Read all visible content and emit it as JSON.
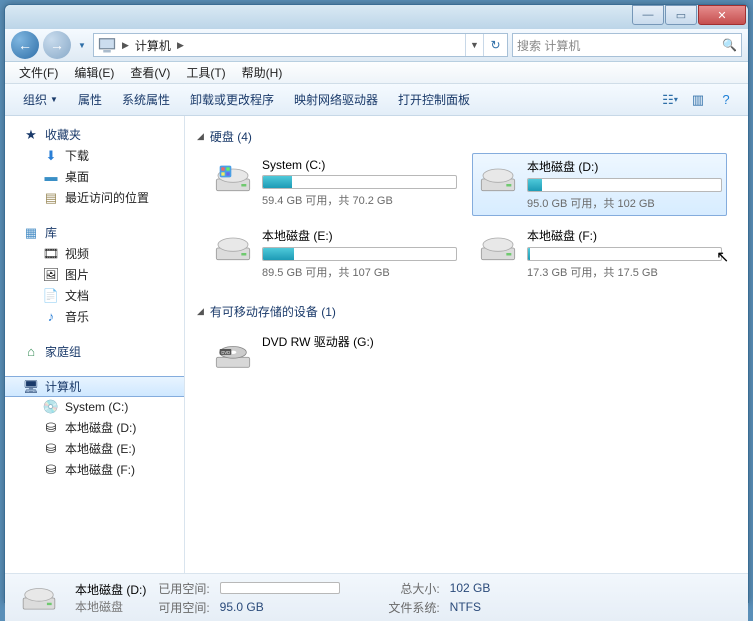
{
  "titlebar": {},
  "nav": {
    "breadcrumb_seg": "计算机",
    "search_placeholder": "搜索 计算机"
  },
  "menubar": {
    "file": "文件(F)",
    "edit": "编辑(E)",
    "view": "查看(V)",
    "tools": "工具(T)",
    "help": "帮助(H)"
  },
  "toolbar": {
    "organize": "组织",
    "properties": "属性",
    "sys_properties": "系统属性",
    "uninstall": "卸载或更改程序",
    "map_drive": "映射网络驱动器",
    "control_panel": "打开控制面板"
  },
  "sidebar": {
    "favorites": {
      "head": "收藏夹",
      "items": [
        "下载",
        "桌面",
        "最近访问的位置"
      ]
    },
    "libraries": {
      "head": "库",
      "items": [
        "视频",
        "图片",
        "文档",
        "音乐"
      ]
    },
    "homegroup": {
      "head": "家庭组"
    },
    "computer": {
      "head": "计算机",
      "items": [
        "System (C:)",
        "本地磁盘 (D:)",
        "本地磁盘 (E:)",
        "本地磁盘 (F:)"
      ]
    }
  },
  "content": {
    "group_hdd": "硬盘 (4)",
    "group_removable": "有可移动存储的设备 (1)",
    "drives": [
      {
        "name": "System (C:)",
        "free": "59.4 GB 可用，共 70.2 GB",
        "pct": 15,
        "selected": false
      },
      {
        "name": "本地磁盘 (D:)",
        "free": "95.0 GB 可用，共 102 GB",
        "pct": 7,
        "selected": true
      },
      {
        "name": "本地磁盘 (E:)",
        "free": "89.5 GB 可用，共 107 GB",
        "pct": 16,
        "selected": false
      },
      {
        "name": "本地磁盘 (F:)",
        "free": "17.3 GB 可用，共 17.5 GB",
        "pct": 1,
        "selected": false
      }
    ],
    "removable": {
      "name": "DVD RW 驱动器 (G:)"
    }
  },
  "details": {
    "title": "本地磁盘 (D:)",
    "subtitle": "本地磁盘",
    "used_label": "已用空间:",
    "used_pct": 7,
    "free_label": "可用空间:",
    "free_val": "95.0 GB",
    "total_label": "总大小:",
    "total_val": "102 GB",
    "fs_label": "文件系统:",
    "fs_val": "NTFS"
  }
}
